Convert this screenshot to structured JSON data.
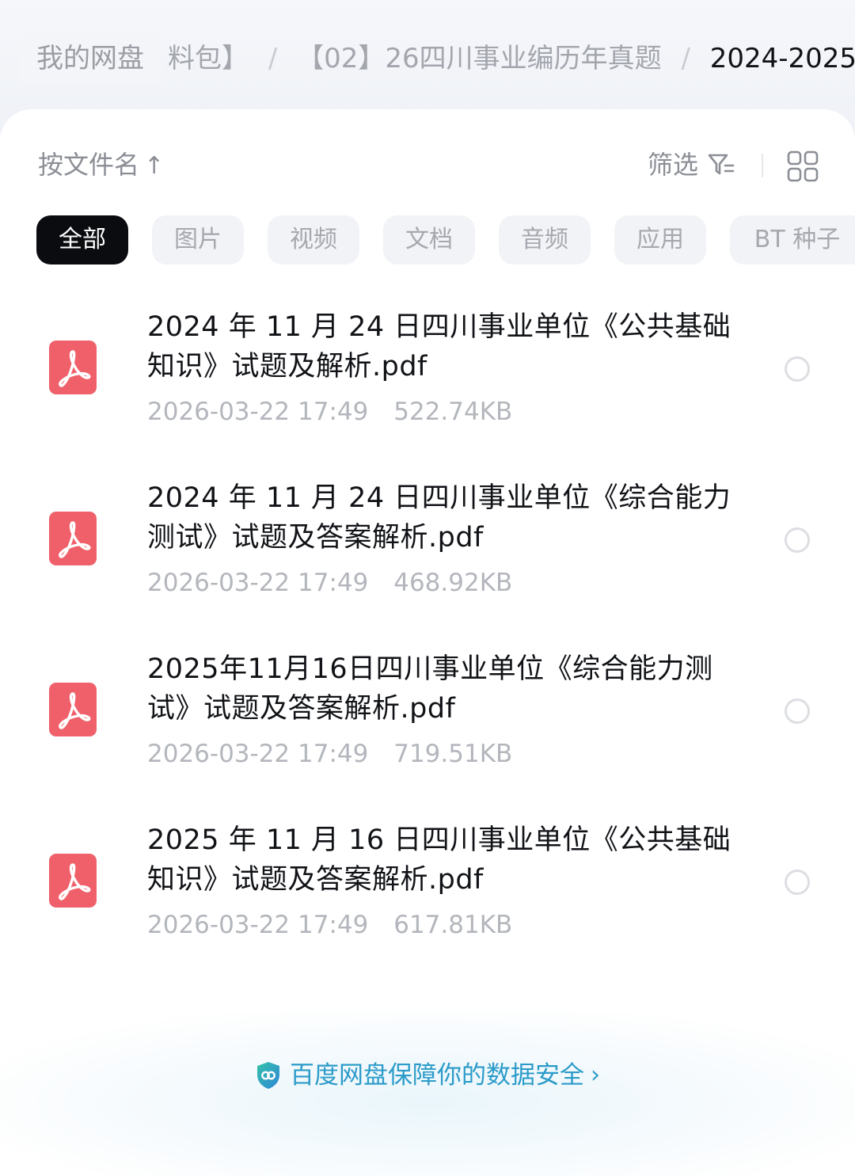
{
  "breadcrumb": {
    "root": "我的网盘",
    "items": [
      "料包】",
      "【02】26四川事业编历年真题",
      "2024-2025"
    ]
  },
  "toolbar": {
    "sort_label": "按文件名",
    "sort_arrow": "↑",
    "filter_label": "筛选"
  },
  "chips": [
    {
      "label": "全部",
      "active": true
    },
    {
      "label": "图片",
      "active": false
    },
    {
      "label": "视频",
      "active": false
    },
    {
      "label": "文档",
      "active": false
    },
    {
      "label": "音频",
      "active": false
    },
    {
      "label": "应用",
      "active": false
    },
    {
      "label": "BT 种子",
      "active": false
    }
  ],
  "files": [
    {
      "name": "2024 年 11 月 24 日四川事业单位《公共基础知识》试题及解析.pdf",
      "date": "2026-03-22",
      "time": "17:49",
      "size": "522.74KB",
      "icon": "pdf-icon"
    },
    {
      "name": "2024 年 11 月 24 日四川事业单位《综合能力测试》试题及答案解析.pdf",
      "date": "2026-03-22",
      "time": "17:49",
      "size": "468.92KB",
      "icon": "pdf-icon"
    },
    {
      "name": "2025年11月16日四川事业单位《综合能力测试》试题及答案解析.pdf",
      "date": "2026-03-22",
      "time": "17:49",
      "size": "719.51KB",
      "icon": "pdf-icon"
    },
    {
      "name": "2025 年 11 月 16 日四川事业单位《公共基础知识》试题及答案解析.pdf",
      "date": "2026-03-22",
      "time": "17:49",
      "size": "617.81KB",
      "icon": "pdf-icon"
    }
  ],
  "footer": {
    "text": "百度网盘保障你的数据安全",
    "chevron": "›"
  },
  "colors": {
    "accent": "#2b9bc9",
    "pdf": "#f0606a",
    "chip_active": "#0b0c10"
  }
}
